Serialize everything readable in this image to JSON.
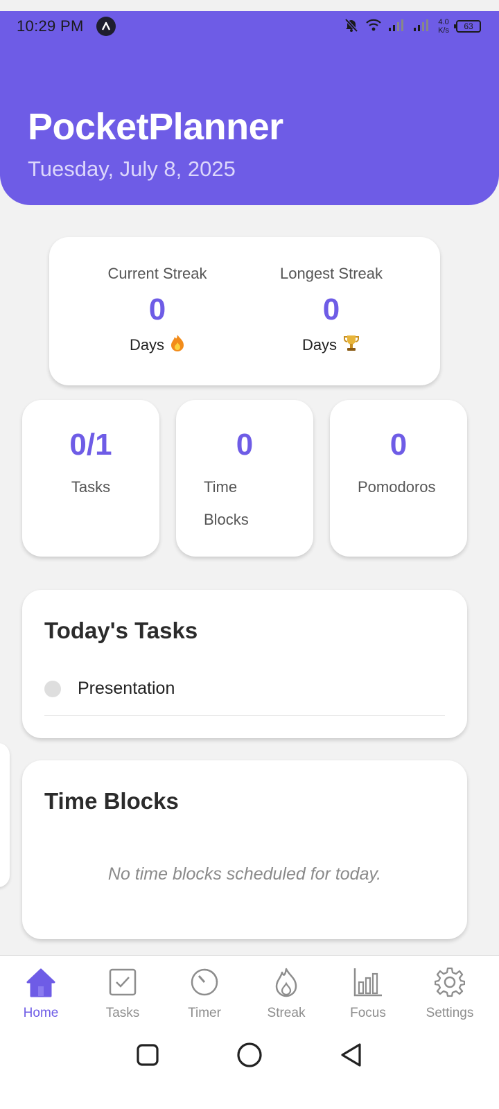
{
  "status_bar": {
    "time": "10:29 PM",
    "speed_value": "4.0",
    "speed_unit": "K/s",
    "battery": "63"
  },
  "header": {
    "title": "PocketPlanner",
    "date": "Tuesday, July 8, 2025"
  },
  "streaks": {
    "current": {
      "label": "Current Streak",
      "value": "0",
      "unit": "Days",
      "icon": "fire-icon"
    },
    "longest": {
      "label": "Longest Streak",
      "value": "0",
      "unit": "Days",
      "icon": "trophy-icon"
    }
  },
  "stats": [
    {
      "value": "0/1",
      "label": "Tasks"
    },
    {
      "value": "0",
      "label": "Time Blocks"
    },
    {
      "value": "0",
      "label": "Pomodoros"
    }
  ],
  "today_tasks": {
    "title": "Today's Tasks",
    "items": [
      {
        "name": "Presentation",
        "done": false
      }
    ]
  },
  "time_blocks": {
    "title": "Time Blocks",
    "empty_message": "No time blocks scheduled for today."
  },
  "nav": {
    "items": [
      {
        "label": "Home",
        "icon": "home-icon",
        "active": true
      },
      {
        "label": "Tasks",
        "icon": "checkbox-icon",
        "active": false
      },
      {
        "label": "Timer",
        "icon": "timer-icon",
        "active": false
      },
      {
        "label": "Streak",
        "icon": "flame-icon",
        "active": false
      },
      {
        "label": "Focus",
        "icon": "bar-chart-icon",
        "active": false
      },
      {
        "label": "Settings",
        "icon": "gear-icon",
        "active": false
      }
    ]
  },
  "colors": {
    "accent": "#6e5ce6",
    "background": "#f2f2f2",
    "card": "#ffffff"
  }
}
